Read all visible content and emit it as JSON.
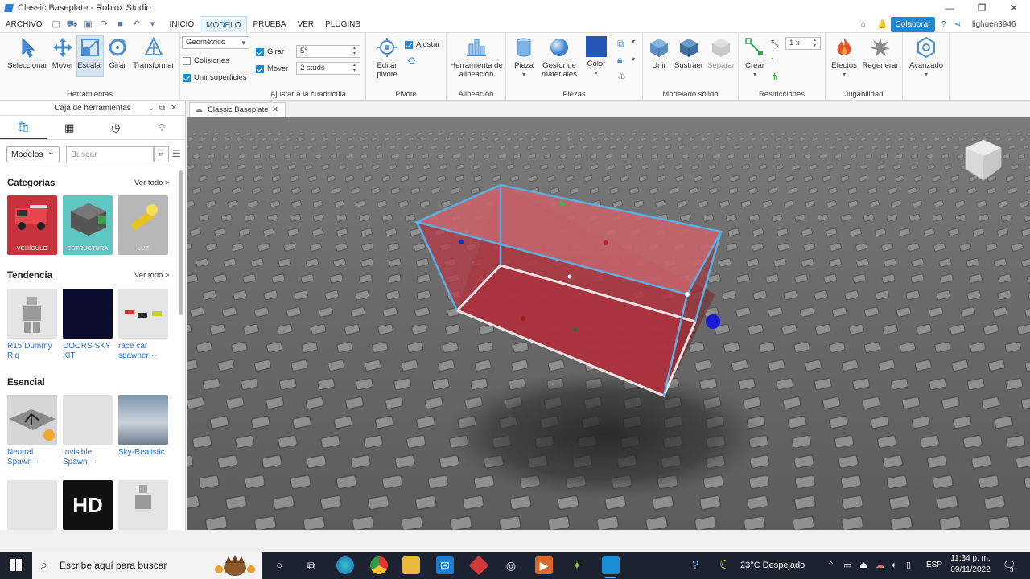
{
  "window": {
    "title": "Classic Baseplate - Roblox Studio",
    "controls": [
      "—",
      "❐",
      "✕"
    ]
  },
  "menu": {
    "file_label": "ARCHIVO",
    "tabs": [
      "INICIO",
      "MODELO",
      "PRUEBA",
      "VER",
      "PLUGINS"
    ],
    "active_tab": "MODELO",
    "collab_label": "Colaborar",
    "username": "lighuen3946"
  },
  "ribbon": {
    "tools": {
      "select": "Seleccionar",
      "move": "Mover",
      "scale": "Escalar",
      "rotate": "Girar",
      "transform": "Transformar",
      "group_title": "Herramientas"
    },
    "snap": {
      "mode_value": "Geométrico",
      "collisions_label": "Colisiones",
      "join_surfaces_label": "Unir superficies",
      "rotate_label": "Girar",
      "rotate_value": "5°",
      "move_label": "Mover",
      "move_value": "2 studs",
      "group_title": "Ajustar a la cuadrícula"
    },
    "pivot": {
      "edit_label": "Editar pivote",
      "snap_label": "Ajustar",
      "group_title": "Pivote"
    },
    "align": {
      "tool_label": "Herramienta de alineación",
      "group_title": "Alineación"
    },
    "parts": {
      "part_label": "Pieza",
      "materials_label": "Gestor de materiales",
      "color_label": "Color",
      "group_title": "Piezas",
      "color_value": "#2456b8"
    },
    "solid": {
      "union_label": "Unir",
      "subtract_label": "Sustraer",
      "separate_label": "Separar",
      "group_title": "Modelado sólido"
    },
    "constraints": {
      "create_label": "Crear",
      "scale_value": "1 x",
      "group_title": "Restricciones"
    },
    "gameplay": {
      "effects_label": "Efectos",
      "regen_label": "Regenerar",
      "group_title": "Jugabilidad"
    },
    "advanced": {
      "label": "Avanzado"
    }
  },
  "toolbox": {
    "title": "Caja de herramientas",
    "tabs": [
      "marketplace-icon",
      "inventory-icon",
      "recent-icon",
      "creations-icon"
    ],
    "filter_value": "Modelos",
    "search_placeholder": "Buscar",
    "sections": [
      {
        "title": "Categorías",
        "see_all": "Ver todo >",
        "items": [
          {
            "label": "VEHÍCULO",
            "bg": "#c8323c"
          },
          {
            "label": "ESTRUCTURA",
            "bg": "#5fc6c2"
          },
          {
            "label": "LUZ",
            "bg": "#b7b7b7"
          }
        ]
      },
      {
        "title": "Tendencia",
        "see_all": "Ver todo >",
        "items": [
          {
            "label": "R15 Dummy Rig"
          },
          {
            "label": "DOORS SKY KIT"
          },
          {
            "label": "race car spawner···"
          }
        ]
      },
      {
        "title": "Esencial",
        "items": [
          {
            "label": "Neutral Spawn···"
          },
          {
            "label": "Invisible Spawn···"
          },
          {
            "label": "Sky-Realistic"
          }
        ]
      }
    ],
    "last_row_badge": "HD"
  },
  "document": {
    "tab_label": "Classic Baseplate"
  },
  "taskbar": {
    "search_placeholder": "Escribe aquí para buscar",
    "weather": "23°C  Despejado",
    "lang": "ESP",
    "time": "11:34 p. m.",
    "date": "09/11/2022",
    "notif_count": "3"
  }
}
